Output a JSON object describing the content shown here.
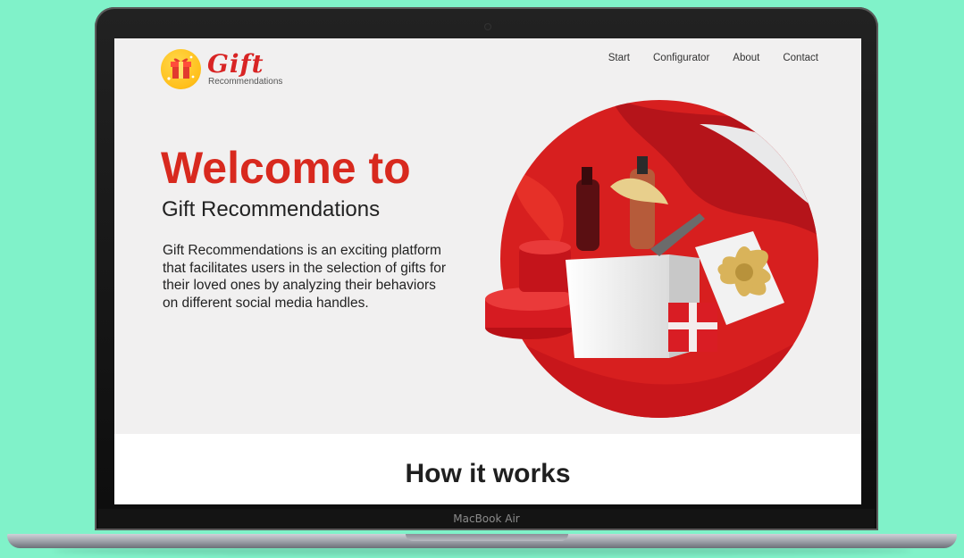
{
  "site": {
    "logo_text": "Gift",
    "logo_subtext": "Recommendations",
    "nav": [
      "Start",
      "Configurator",
      "About",
      "Contact"
    ]
  },
  "hero": {
    "title": "Welcome to",
    "subtitle": "Gift Recommendations",
    "description": "Gift Recommendations is an exciting platform that facilitates users in the selection of gifts for their loved ones by analyzing their behaviors on different social media handles."
  },
  "how_it_works": {
    "title": "How it works"
  },
  "device": {
    "label": "MacBook Air"
  },
  "colors": {
    "background": "#80f2c9",
    "brand_red": "#d8291e",
    "screen_bg": "#f1f0f0"
  },
  "icons": [
    "gift-icon"
  ]
}
